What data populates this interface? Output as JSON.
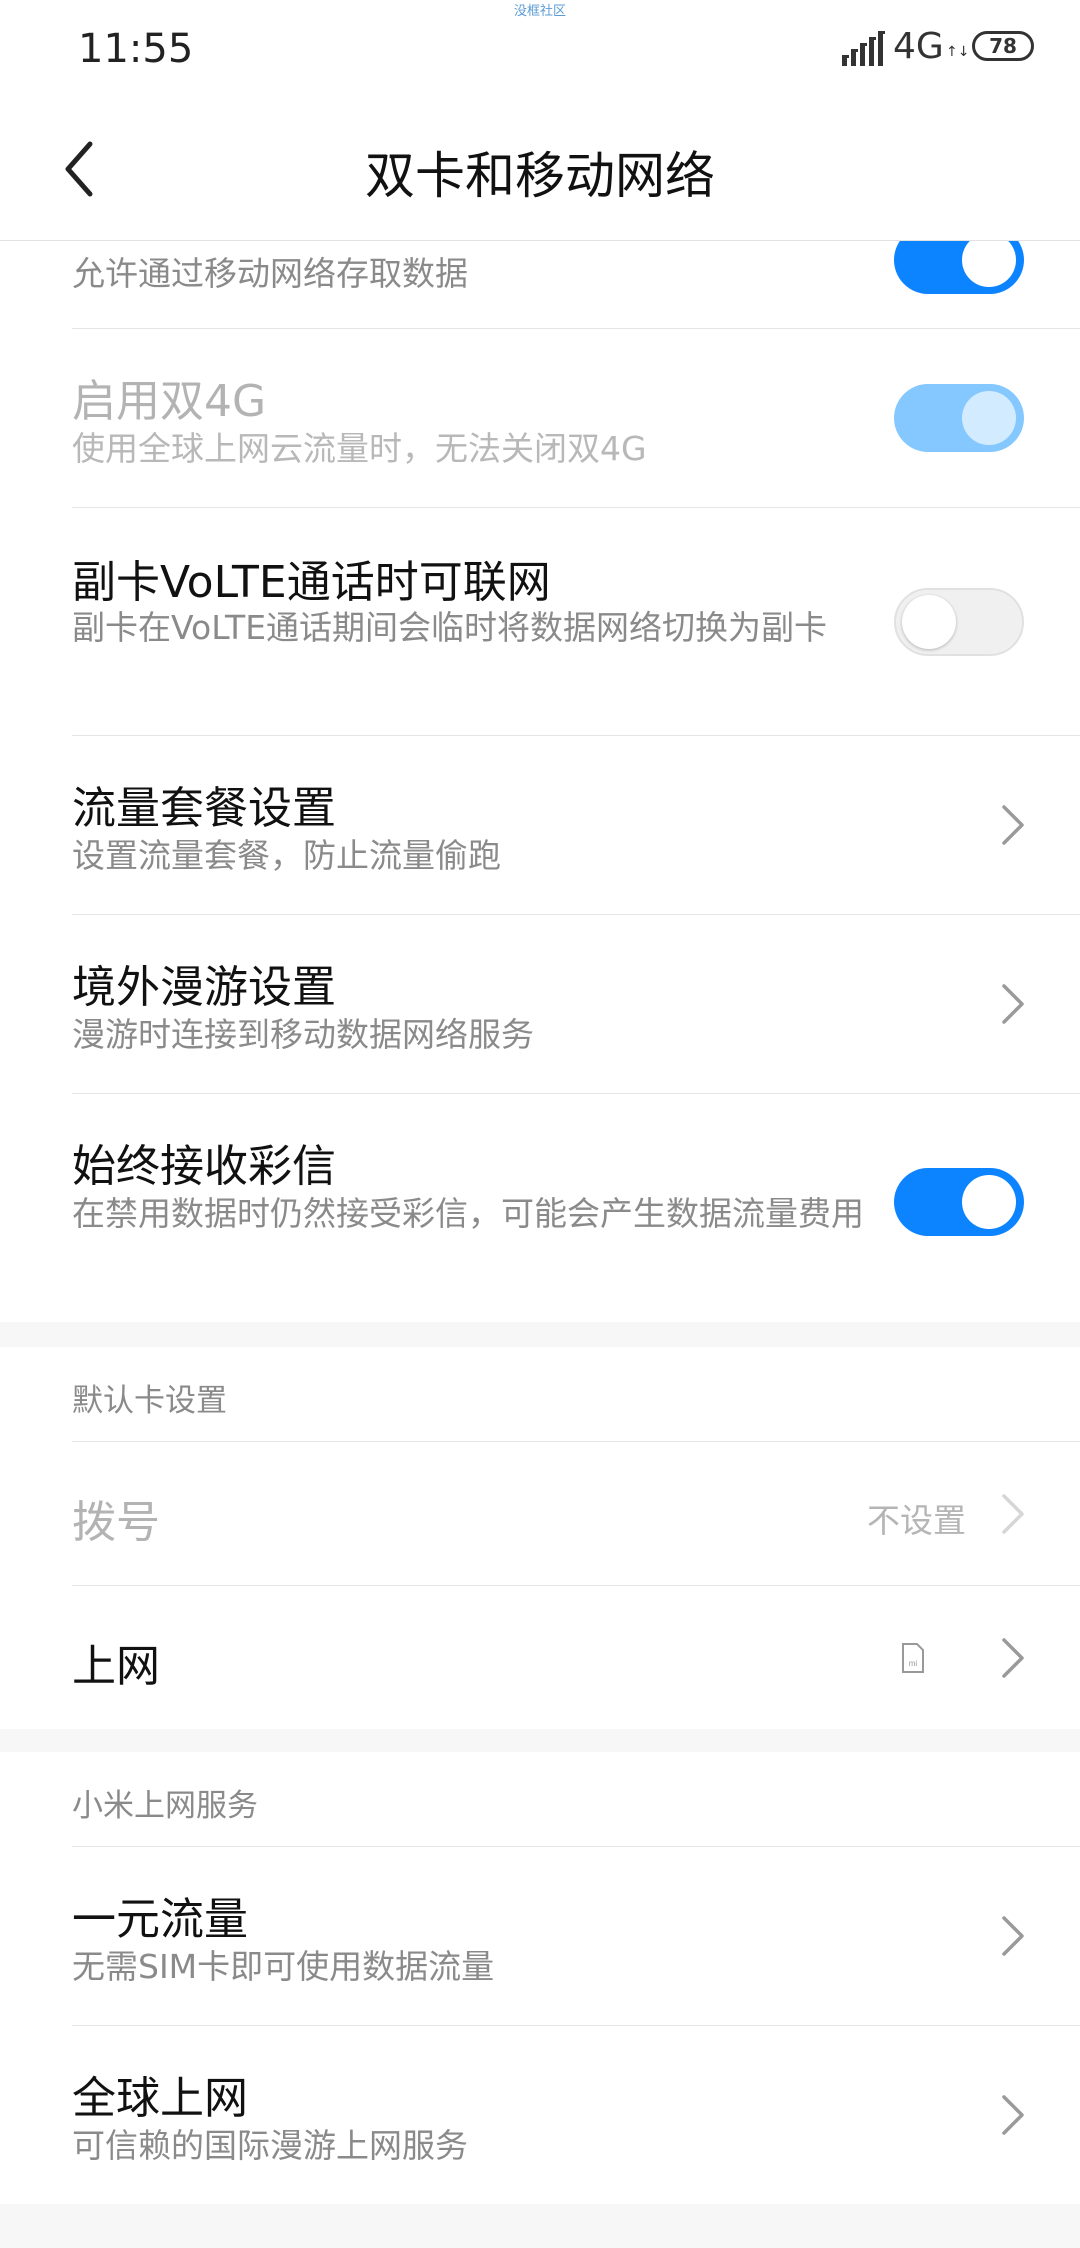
{
  "status_bar": {
    "time": "11:55",
    "watermark": "没框社区",
    "network": "4G",
    "network_arrows": "↑↓",
    "battery": "78"
  },
  "header": {
    "title": "双卡和移动网络",
    "back_icon": "chevron-left-icon"
  },
  "settings": {
    "mobile_data": {
      "subtitle": "允许通过移动网络存取数据",
      "toggle": "on"
    },
    "dual_4g": {
      "title": "启用双4G",
      "subtitle": "使用全球上网云流量时，无法关闭双4G",
      "toggle": "on-disabled"
    },
    "volte_data": {
      "title": "副卡VoLTE通话时可联网",
      "subtitle": "副卡在VoLTE通话期间会临时将数据网络切换为副卡",
      "toggle": "off"
    },
    "data_plan": {
      "title": "流量套餐设置",
      "subtitle": "设置流量套餐，防止流量偷跑"
    },
    "roaming": {
      "title": "境外漫游设置",
      "subtitle": "漫游时连接到移动数据网络服务"
    },
    "mms": {
      "title": "始终接收彩信",
      "subtitle": "在禁用数据时仍然接受彩信，可能会产生数据流量费用",
      "toggle": "on"
    }
  },
  "default_card": {
    "header": "默认卡设置",
    "dial": {
      "title": "拨号",
      "value": "不设置"
    },
    "internet": {
      "title": "上网",
      "icon": "sim-card-icon"
    }
  },
  "mi_services": {
    "header": "小米上网服务",
    "one_yuan": {
      "title": "一元流量",
      "subtitle": "无需SIM卡即可使用数据流量"
    },
    "global": {
      "title": "全球上网",
      "subtitle": "可信赖的国际漫游上网服务"
    }
  },
  "colors": {
    "accent": "#0d84ff",
    "accent_disabled": "#84c8ff",
    "text_primary": "#111111",
    "text_secondary": "#8a8a8a",
    "background": "#f7f7f7"
  }
}
